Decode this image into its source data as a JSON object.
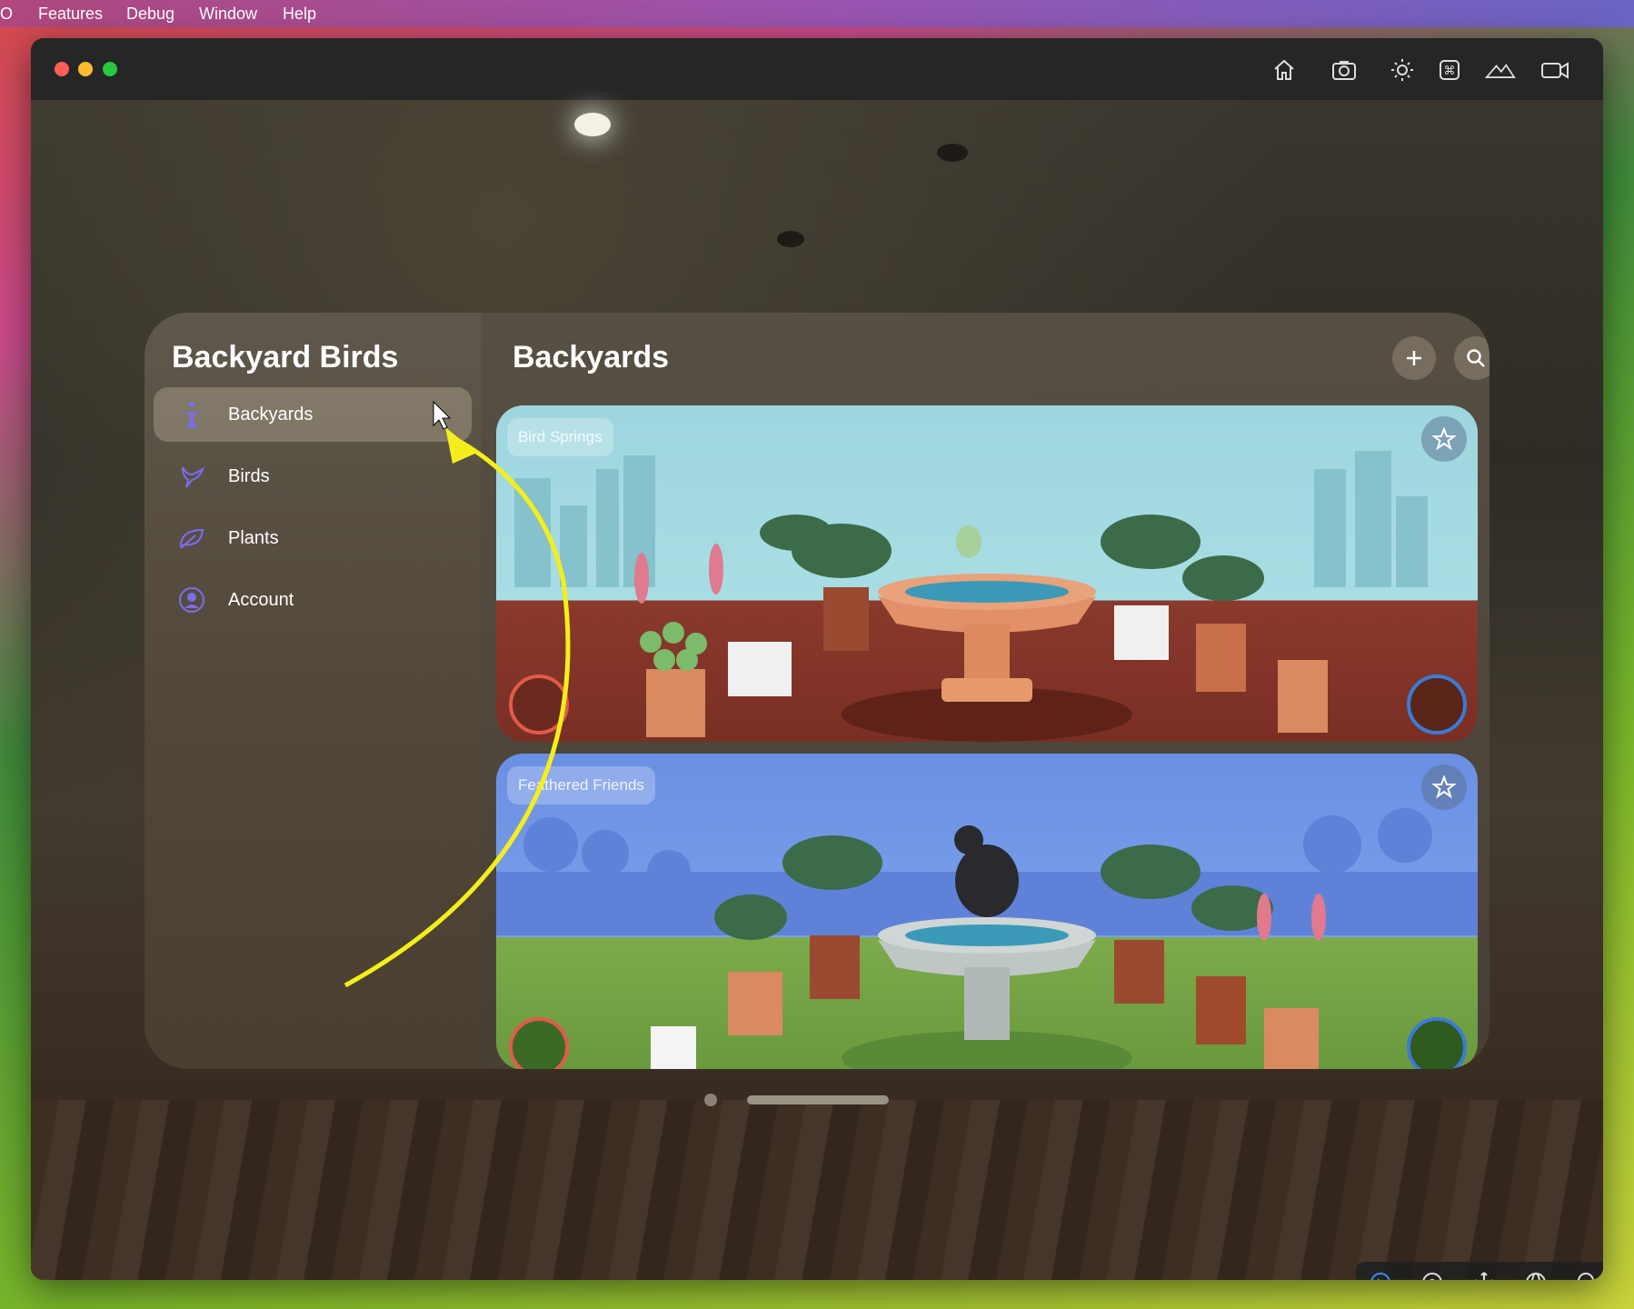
{
  "menubar": {
    "items": [
      "O",
      "Features",
      "Debug",
      "Window",
      "Help"
    ]
  },
  "window": {
    "toolbar_icons": [
      "home-icon",
      "screenshot-icon",
      "brightness-icon",
      "command-icon",
      "landscape-icon",
      "record-video-icon"
    ],
    "bottom_tools": [
      "select-pointer-icon",
      "focus-icon",
      "move-icon",
      "orbit-icon",
      "zoom-icon"
    ]
  },
  "app": {
    "title": "Backyard Birds",
    "nav": [
      {
        "label": "Backyards",
        "icon": "backyard-birdbath-icon",
        "selected": true
      },
      {
        "label": "Birds",
        "icon": "bird-icon",
        "selected": false
      },
      {
        "label": "Plants",
        "icon": "leaf-icon",
        "selected": false
      },
      {
        "label": "Account",
        "icon": "person-circle-icon",
        "selected": false
      }
    ],
    "main_title": "Backyards",
    "cards": [
      {
        "name": "Bird Springs",
        "supply_icon": "seeds-icon",
        "water_icon": "water-drop-icon"
      },
      {
        "name": "Feathered Friends",
        "supply_icon": "food-icon",
        "water_icon": "water-drop-icon"
      }
    ],
    "accent": "#7c6cf0"
  }
}
